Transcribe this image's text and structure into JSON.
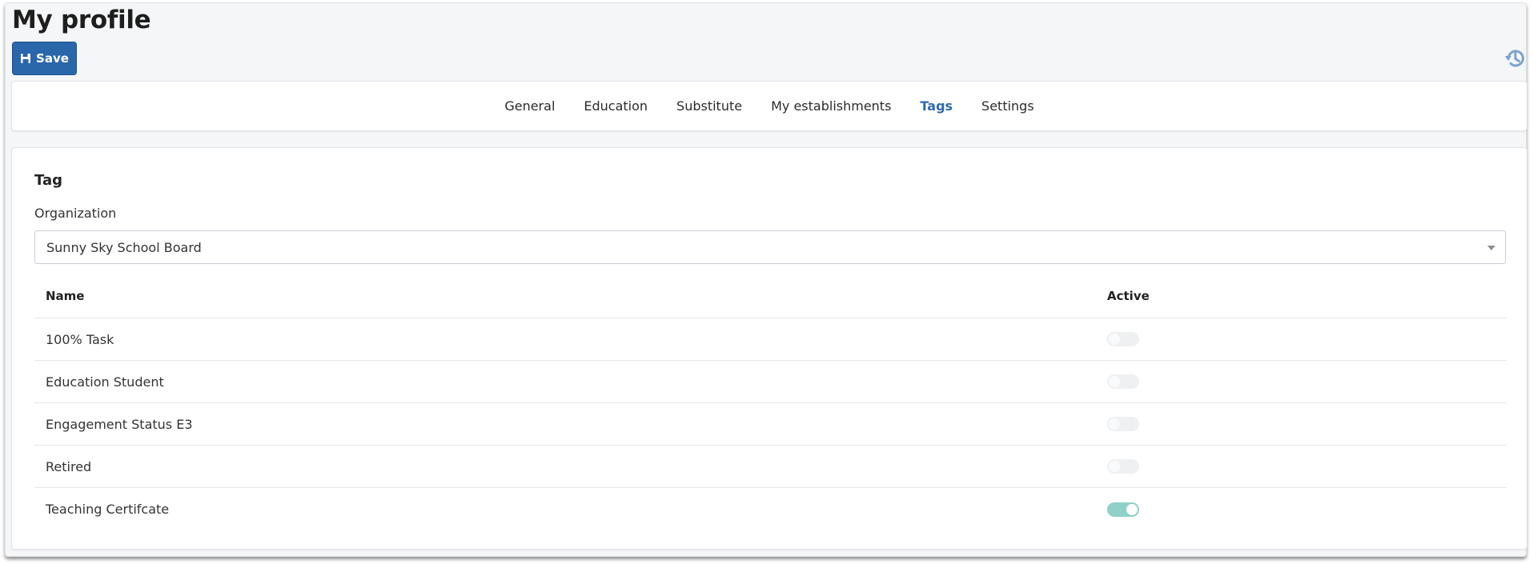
{
  "page": {
    "title": "My profile"
  },
  "toolbar": {
    "save_label": "Save",
    "save_icon": "floppy-disk-icon",
    "history_icon": "history-icon"
  },
  "tabs": [
    {
      "label": "General",
      "active": false
    },
    {
      "label": "Education",
      "active": false
    },
    {
      "label": "Substitute",
      "active": false
    },
    {
      "label": "My establishments",
      "active": false
    },
    {
      "label": "Tags",
      "active": true
    },
    {
      "label": "Settings",
      "active": false
    }
  ],
  "section": {
    "title": "Tag",
    "organization_label": "Organization",
    "organization_value": "Sunny Sky School Board"
  },
  "table": {
    "headers": {
      "name": "Name",
      "active": "Active"
    },
    "rows": [
      {
        "name": "100% Task",
        "active": false
      },
      {
        "name": "Education Student",
        "active": false
      },
      {
        "name": "Engagement Status E3",
        "active": false
      },
      {
        "name": "Retired",
        "active": false
      },
      {
        "name": "Teaching Certifcate",
        "active": true
      }
    ]
  },
  "colors": {
    "primary": "#2a66aa",
    "active_tab": "#2e6aaf",
    "toggle_on": "#8fd1c8",
    "toggle_off": "#eef0f2"
  }
}
